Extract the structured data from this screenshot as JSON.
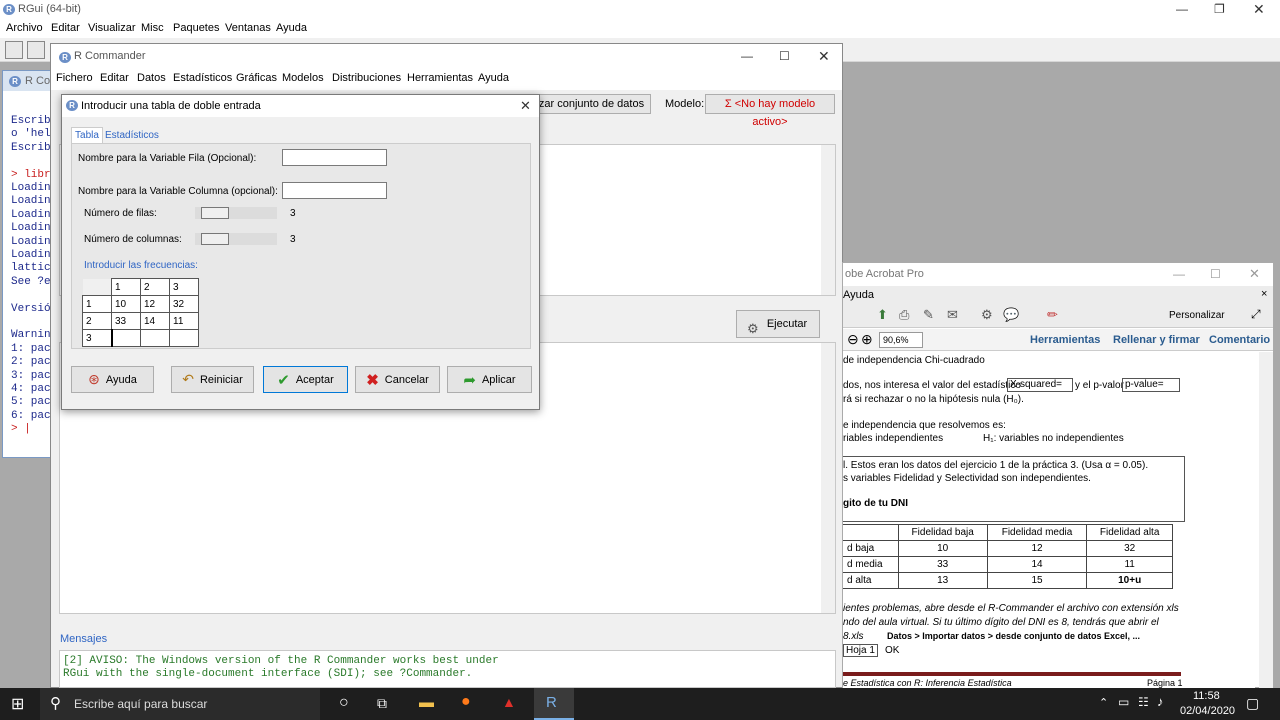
{
  "rgui": {
    "title": "RGui (64-bit)",
    "menu": [
      "Archivo",
      "Editar",
      "Visualizar",
      "Misc",
      "Paquetes",
      "Ventanas",
      "Ayuda"
    ],
    "console_title": "R Co",
    "console_lines": [
      "Escrib",
      "o 'hel",
      "Escrib",
      "",
      "> libr",
      "Loadin",
      "Loadin",
      "Loadin",
      "Loadin",
      "Loadin",
      "Loadin",
      "lattic",
      "See ?e",
      "",
      "Versió",
      "",
      "Warnin",
      "1: pac",
      "2: pac",
      "3: pac",
      "4: pac",
      "5: pac",
      "6: pac",
      "> |"
    ]
  },
  "rcmdr": {
    "title": "R Commander",
    "menu": [
      "Fichero",
      "Editar",
      "Datos",
      "Estadísticos",
      "Gráficas",
      "Modelos",
      "Distribuciones",
      "Herramientas",
      "Ayuda"
    ],
    "dataset_btn": "alizar conjunto de datos",
    "model_label": "Modelo:",
    "model_value": "Σ <No hay modelo activo>",
    "execute_btn": "Ejecutar",
    "messages_label": "Mensajes",
    "messages_text": [
      "[2] AVISO: The Windows version of the R Commander works best under",
      "RGui with the single-document interface (SDI); see ?Commander."
    ]
  },
  "dialog": {
    "title": "Introducir una tabla de doble entrada",
    "tabs": [
      "Tabla",
      "Estadísticos"
    ],
    "row_var_label": "Nombre para la Variable  Fila (Opcional):",
    "row_var_value": "",
    "col_var_label": "Nombre para la Variable Columna (opcional):",
    "col_var_value": "",
    "rows_label": "Número de filas:",
    "rows_value": "3",
    "cols_label": "Número de columnas:",
    "cols_value": "3",
    "freq_label": "Introducir las frecuencias:",
    "grid_header": [
      "",
      "1",
      "2",
      "3"
    ],
    "grid_rows": [
      [
        "1",
        "10",
        "12",
        "32"
      ],
      [
        "2",
        "33",
        "14",
        "11"
      ],
      [
        "3",
        "",
        "",
        ""
      ]
    ],
    "buttons": {
      "help": "Ayuda",
      "reset": "Reiniciar",
      "ok": "Aceptar",
      "cancel": "Cancelar",
      "apply": "Aplicar"
    }
  },
  "acrobat": {
    "title": "obe Acrobat Pro",
    "menu": "Ayuda",
    "customize": "Personalizar",
    "zoom": "90,6%",
    "nav": [
      "Herramientas",
      "Rellenar y firmar",
      "Comentario"
    ],
    "doc_lines": [
      "de independencia Chi-cuadrado",
      "dos, nos interesa el valor del estadístico",
      "X-squared=",
      "y el p-valor",
      "p-value=",
      "rá si rechazar o no la hipótesis nula (H₀).",
      "e independencia que resolvemos es:",
      "riables independientes",
      "H₁: variables no independientes",
      "l. Estos eran los datos del ejercicio 1 de la práctica 3. (Usa α = 0.05).",
      "s variables Fidelidad y Selectividad son independientes.",
      "gito de tu DNI",
      "ientes problemas, abre desde el R-Commander el archivo con extensión xls",
      "ndo del aula virtual.  Si tu último dígito del DNI es 8, tendrás que abrir el",
      "8.xls",
      "Datos > Importar datos > desde conjunto de datos Excel, ...",
      "Hoja 1",
      "OK",
      "e Estadística con R: Inferencia Estadística",
      "Página 1"
    ],
    "table_header": [
      "",
      "Fidelidad baja",
      "Fidelidad media",
      "Fidelidad alta"
    ],
    "table_rows": [
      [
        "d baja",
        "10",
        "12",
        "32"
      ],
      [
        "d media",
        "33",
        "14",
        "11"
      ],
      [
        "d alta",
        "13",
        "15",
        "10+u"
      ]
    ]
  },
  "taskbar": {
    "search_placeholder": "Escribe aquí para buscar",
    "time": "11:58",
    "date": "02/04/2020"
  },
  "colors": {
    "accent": "#0078d7",
    "link_blue": "#2f65c4",
    "model_red": "#d00000",
    "console_blue": "#1e2a8c"
  }
}
